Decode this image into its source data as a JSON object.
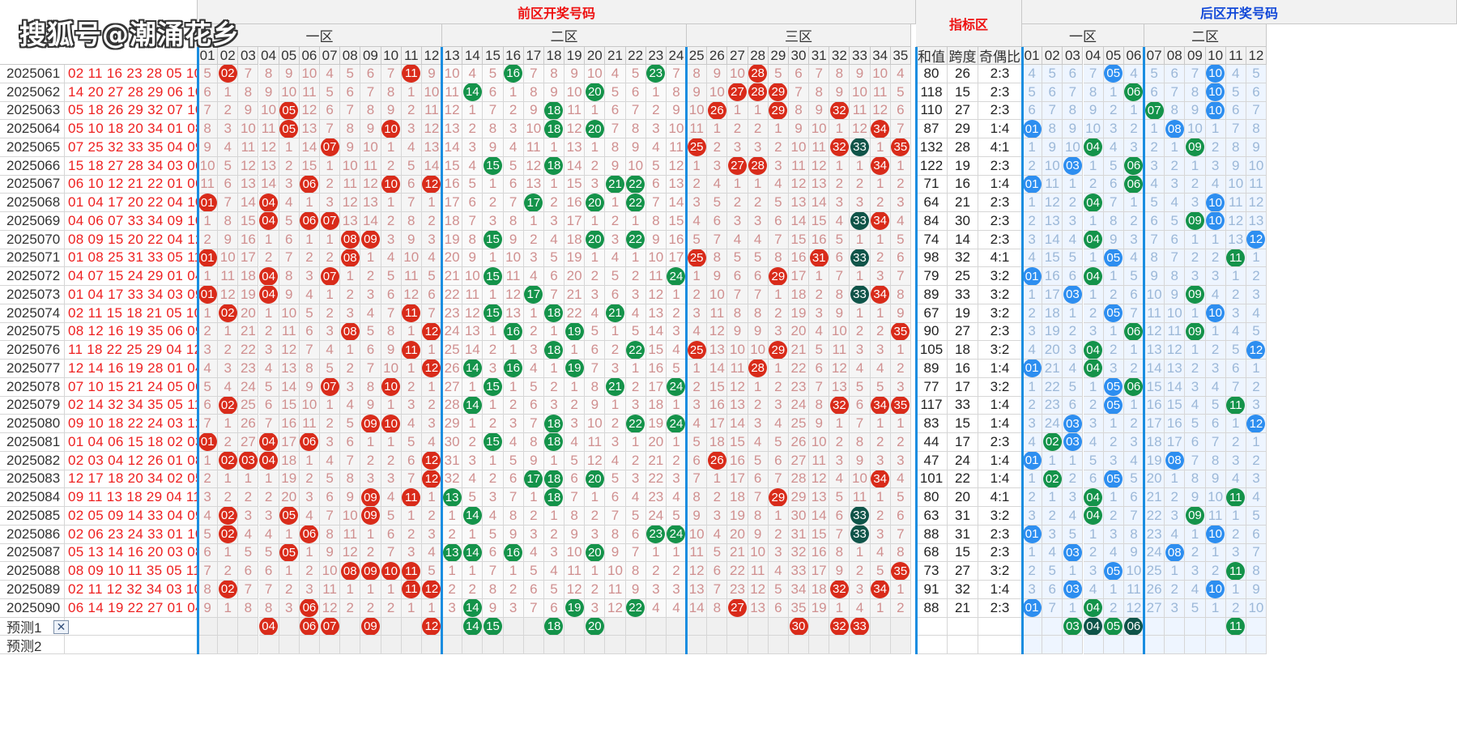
{
  "watermark": "搜狐号@潮涌花乡",
  "headers": {
    "front": "前区开奖号码",
    "index": "指标区",
    "back": "后区开奖号码",
    "front_zones": [
      "一区",
      "二区",
      "三区"
    ],
    "back_zones": [
      "一区",
      "二区"
    ],
    "stats": [
      "和值",
      "跨度",
      "奇偶比"
    ]
  },
  "prediction_labels": [
    "预测1",
    "预测2"
  ],
  "close_icon": "✕",
  "colors": {
    "red": "#d92b1a",
    "green": "#14934a",
    "teal": "#0f5449",
    "blue": "#2d8ef0",
    "accent_line": "#1a8de0",
    "header_red": "#ee1111",
    "header_blue": "#1148d8"
  },
  "rows": [
    {
      "period": "2025061",
      "front": [
        2,
        11,
        16,
        23,
        28
      ],
      "back": [
        5,
        10
      ],
      "sum": 80,
      "span": 26,
      "ratio": "2:3"
    },
    {
      "period": "2025062",
      "front": [
        14,
        20,
        27,
        28,
        29
      ],
      "back": [
        6,
        10
      ],
      "sum": 118,
      "span": 15,
      "ratio": "2:3"
    },
    {
      "period": "2025063",
      "front": [
        5,
        18,
        26,
        29,
        32
      ],
      "back": [
        7,
        10
      ],
      "sum": 110,
      "span": 27,
      "ratio": "2:3"
    },
    {
      "period": "2025064",
      "front": [
        5,
        10,
        18,
        20,
        34
      ],
      "back": [
        1,
        8
      ],
      "sum": 87,
      "span": 29,
      "ratio": "1:4"
    },
    {
      "period": "2025065",
      "front": [
        7,
        25,
        32,
        33,
        35
      ],
      "back": [
        4,
        9
      ],
      "sum": 132,
      "span": 28,
      "ratio": "4:1"
    },
    {
      "period": "2025066",
      "front": [
        15,
        18,
        27,
        28,
        34
      ],
      "back": [
        3,
        6
      ],
      "sum": 122,
      "span": 19,
      "ratio": "2:3"
    },
    {
      "period": "2025067",
      "front": [
        6,
        10,
        12,
        21,
        22
      ],
      "back": [
        1,
        6
      ],
      "sum": 71,
      "span": 16,
      "ratio": "1:4"
    },
    {
      "period": "2025068",
      "front": [
        1,
        4,
        17,
        20,
        22
      ],
      "back": [
        4,
        10
      ],
      "sum": 64,
      "span": 21,
      "ratio": "2:3"
    },
    {
      "period": "2025069",
      "front": [
        4,
        6,
        7,
        33,
        34
      ],
      "back": [
        9,
        10
      ],
      "sum": 84,
      "span": 30,
      "ratio": "2:3"
    },
    {
      "period": "2025070",
      "front": [
        8,
        9,
        15,
        20,
        22
      ],
      "back": [
        4,
        12
      ],
      "sum": 74,
      "span": 14,
      "ratio": "2:3"
    },
    {
      "period": "2025071",
      "front": [
        1,
        8,
        25,
        31,
        33
      ],
      "back": [
        5,
        11
      ],
      "sum": 98,
      "span": 32,
      "ratio": "4:1"
    },
    {
      "period": "2025072",
      "front": [
        4,
        7,
        15,
        24,
        29
      ],
      "back": [
        1,
        4
      ],
      "sum": 79,
      "span": 25,
      "ratio": "3:2"
    },
    {
      "period": "2025073",
      "front": [
        1,
        4,
        17,
        33,
        34
      ],
      "back": [
        3,
        9
      ],
      "sum": 89,
      "span": 33,
      "ratio": "3:2"
    },
    {
      "period": "2025074",
      "front": [
        2,
        11,
        15,
        18,
        21
      ],
      "back": [
        5,
        10
      ],
      "sum": 67,
      "span": 19,
      "ratio": "3:2"
    },
    {
      "period": "2025075",
      "front": [
        8,
        12,
        16,
        19,
        35
      ],
      "back": [
        6,
        9
      ],
      "sum": 90,
      "span": 27,
      "ratio": "2:3"
    },
    {
      "period": "2025076",
      "front": [
        11,
        18,
        22,
        25,
        29
      ],
      "back": [
        4,
        12
      ],
      "sum": 105,
      "span": 18,
      "ratio": "3:2"
    },
    {
      "period": "2025077",
      "front": [
        12,
        14,
        16,
        19,
        28
      ],
      "back": [
        1,
        4
      ],
      "sum": 89,
      "span": 16,
      "ratio": "1:4"
    },
    {
      "period": "2025078",
      "front": [
        7,
        10,
        15,
        21,
        24
      ],
      "back": [
        5,
        6
      ],
      "sum": 77,
      "span": 17,
      "ratio": "3:2"
    },
    {
      "period": "2025079",
      "front": [
        2,
        14,
        32,
        34,
        35
      ],
      "back": [
        5,
        11
      ],
      "sum": 117,
      "span": 33,
      "ratio": "1:4"
    },
    {
      "period": "2025080",
      "front": [
        9,
        10,
        18,
        22,
        24
      ],
      "back": [
        3,
        12
      ],
      "sum": 83,
      "span": 15,
      "ratio": "1:4"
    },
    {
      "period": "2025081",
      "front": [
        1,
        4,
        6,
        15,
        18
      ],
      "back": [
        2,
        3
      ],
      "sum": 44,
      "span": 17,
      "ratio": "2:3"
    },
    {
      "period": "2025082",
      "front": [
        2,
        3,
        4,
        12,
        26
      ],
      "back": [
        1,
        8
      ],
      "sum": 47,
      "span": 24,
      "ratio": "1:4"
    },
    {
      "period": "2025083",
      "front": [
        12,
        17,
        18,
        20,
        34
      ],
      "back": [
        2,
        5
      ],
      "sum": 101,
      "span": 22,
      "ratio": "1:4"
    },
    {
      "period": "2025084",
      "front": [
        9,
        11,
        13,
        18,
        29
      ],
      "back": [
        4,
        11
      ],
      "sum": 80,
      "span": 20,
      "ratio": "4:1"
    },
    {
      "period": "2025085",
      "front": [
        2,
        5,
        9,
        14,
        33
      ],
      "back": [
        4,
        9
      ],
      "sum": 63,
      "span": 31,
      "ratio": "3:2"
    },
    {
      "period": "2025086",
      "front": [
        2,
        6,
        23,
        24,
        33
      ],
      "back": [
        1,
        10
      ],
      "sum": 88,
      "span": 31,
      "ratio": "2:3"
    },
    {
      "period": "2025087",
      "front": [
        5,
        13,
        14,
        16,
        20
      ],
      "back": [
        3,
        8
      ],
      "sum": 68,
      "span": 15,
      "ratio": "2:3"
    },
    {
      "period": "2025088",
      "front": [
        8,
        9,
        10,
        11,
        35
      ],
      "back": [
        5,
        11
      ],
      "sum": 73,
      "span": 27,
      "ratio": "3:2"
    },
    {
      "period": "2025089",
      "front": [
        2,
        11,
        12,
        32,
        34
      ],
      "back": [
        3,
        10
      ],
      "sum": 91,
      "span": 32,
      "ratio": "1:4"
    },
    {
      "period": "2025090",
      "front": [
        6,
        14,
        19,
        22,
        27
      ],
      "back": [
        1,
        4
      ],
      "sum": 88,
      "span": 21,
      "ratio": "2:3"
    }
  ],
  "prediction1": {
    "front": [
      4,
      6,
      7,
      9,
      12,
      14,
      15,
      18,
      20,
      30,
      32,
      33
    ],
    "back": [
      3,
      4,
      5,
      6,
      11
    ]
  }
}
